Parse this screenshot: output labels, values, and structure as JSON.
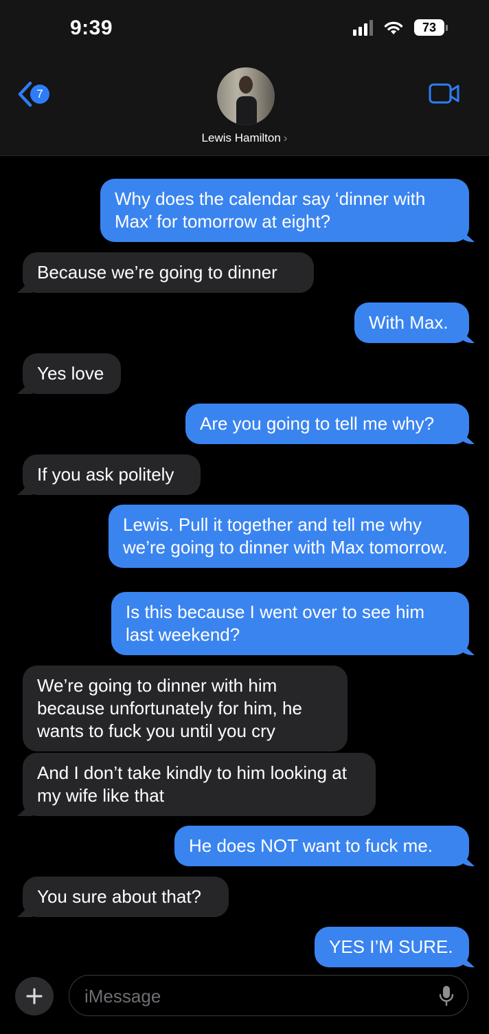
{
  "status_bar": {
    "time": "9:39",
    "battery": "73"
  },
  "header": {
    "back_count": "7",
    "contact_name": "Lewis Hamilton",
    "chevron": "›"
  },
  "messages": [
    {
      "side": "sent",
      "text": "Why does the calendar say ‘dinner with Max’ for tomorrow at eight?"
    },
    {
      "side": "received",
      "text": "Because we’re going to dinner"
    },
    {
      "side": "sent",
      "text": "With Max."
    },
    {
      "side": "received",
      "text": "Yes love"
    },
    {
      "side": "sent",
      "text": "Are you going to tell me why?"
    },
    {
      "side": "received",
      "text": "If you ask politely"
    },
    {
      "side": "sent",
      "text": "Lewis. Pull it together and tell me why we’re going to dinner with Max tomorrow."
    },
    {
      "side": "sent",
      "text": "Is this because I went over to see him last weekend?"
    },
    {
      "side": "received",
      "text": "We’re going to dinner with him because unfortunately for him, he wants to fuck you until you cry"
    },
    {
      "side": "received",
      "text": "And I don’t take kindly to him looking at my wife like that"
    },
    {
      "side": "sent",
      "text": "He does NOT want to fuck me."
    },
    {
      "side": "received",
      "text": "You sure about that?"
    },
    {
      "side": "sent",
      "text": "YES I’M SURE."
    }
  ],
  "composer": {
    "placeholder": "iMessage"
  },
  "colors": {
    "sent": "#3a84f0",
    "received": "#262628",
    "accent": "#2f7df6"
  },
  "icons": [
    "back-chevron-icon",
    "video-call-icon",
    "plus-icon",
    "microphone-icon",
    "cellular-signal-icon",
    "wifi-icon",
    "battery-icon"
  ]
}
